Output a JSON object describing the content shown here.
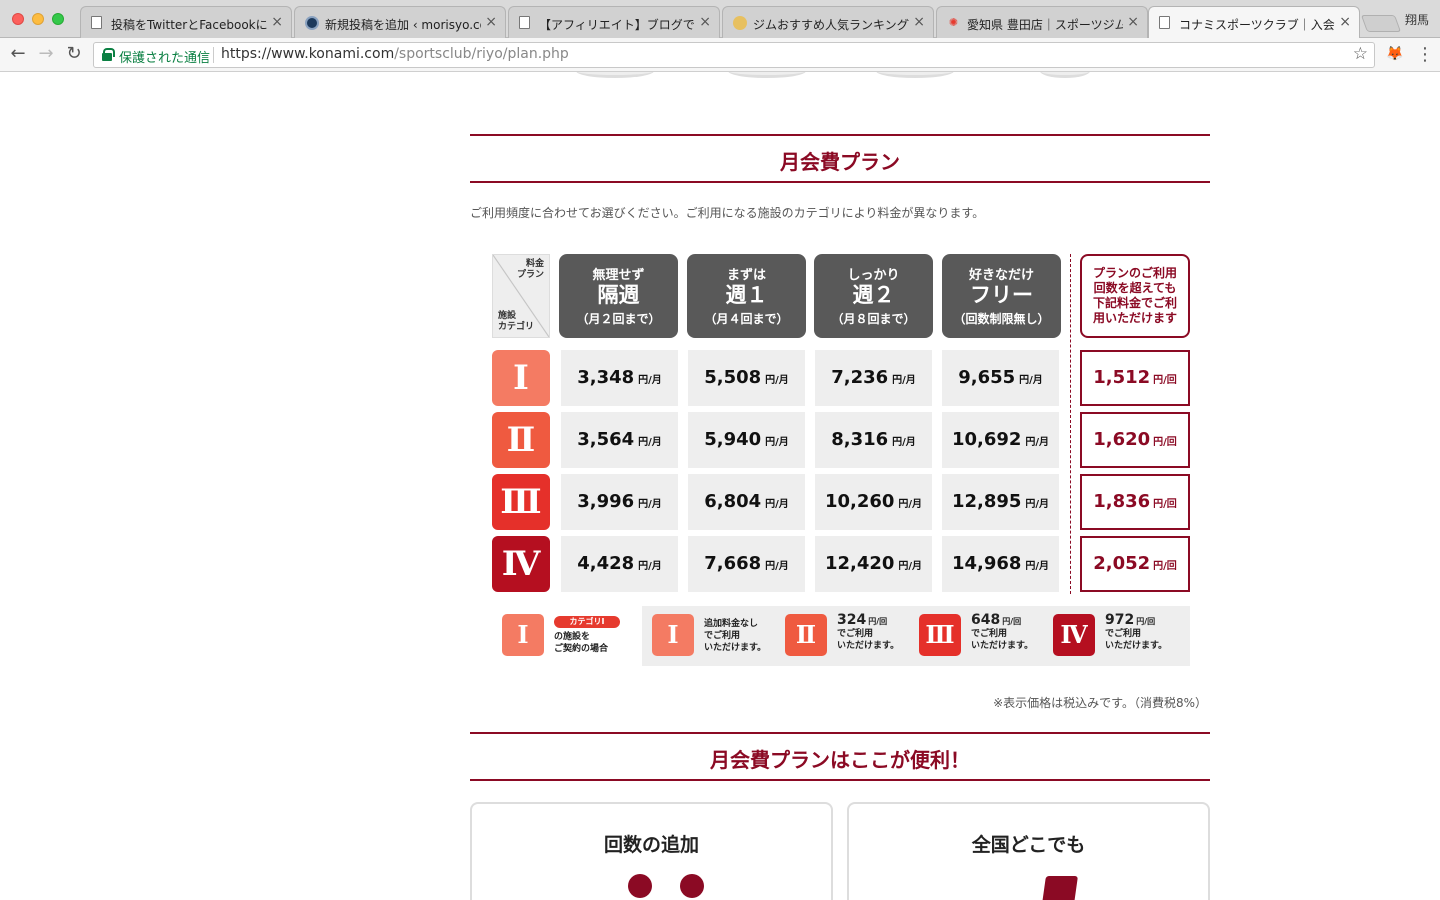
{
  "browser": {
    "tabs": [
      {
        "title": "投稿をTwitterとFacebookに自動",
        "favicon": "doc"
      },
      {
        "title": "新規投稿を追加 ‹ morisyo.com",
        "favicon": "wp"
      },
      {
        "title": "【アフィリエイト】ブログで月",
        "favicon": "doc"
      },
      {
        "title": "ジムおすすめ人気ランキングTO",
        "favicon": "gym"
      },
      {
        "title": "愛知県 豊田店｜スポーツジム、",
        "favicon": "ken"
      },
      {
        "title": "コナミスポーツクラブ｜入会案内",
        "favicon": "doc"
      }
    ],
    "active_tab": 5,
    "profile_name": "翔馬",
    "secure_label": "保護された通信",
    "url_host": "https://www.konami.com",
    "url_path": "/sportsclub/riyo/plan.php"
  },
  "page": {
    "section1_title": "月会費プラン",
    "intro": "ご利用頻度に合わせてお選びください。ご利用になる施設のカテゴリにより料金が異なります。",
    "corner_top": "料金\nプラン",
    "corner_bottom": "施設\nカテゴリ",
    "plans": [
      {
        "sub": "無理せず",
        "name": "隔週",
        "note": "（月２回まで）"
      },
      {
        "sub": "まずは",
        "name": "週１",
        "note": "（月４回まで）"
      },
      {
        "sub": "しっかり",
        "name": "週２",
        "note": "（月８回まで）"
      },
      {
        "sub": "好きなだけ",
        "name": "フリー",
        "note": "（回数制限無し）"
      }
    ],
    "extra_header": "プランのご利用回数を超えても下記料金でご利用いただけます",
    "monthly_unit": "円/月",
    "per_visit_unit": "円/回",
    "categories": [
      {
        "label": "Ⅰ",
        "color": "#f47b63",
        "prices": [
          "3,348",
          "5,508",
          "7,236",
          "9,655"
        ],
        "extra": "1,512"
      },
      {
        "label": "Ⅱ",
        "color": "#ef5a40",
        "prices": [
          "3,564",
          "5,940",
          "8,316",
          "10,692"
        ],
        "extra": "1,620"
      },
      {
        "label": "Ⅲ",
        "color": "#e5302a",
        "prices": [
          "3,996",
          "6,804",
          "10,260",
          "12,895"
        ],
        "extra": "1,836"
      },
      {
        "label": "Ⅳ",
        "color": "#b50f20",
        "prices": [
          "4,428",
          "7,668",
          "12,420",
          "14,968"
        ],
        "extra": "2,052"
      }
    ],
    "legend": {
      "pill": "カテゴリⅠ",
      "contract_text": "の施設を\nご契約の場合",
      "first_text": "追加料金なし\nでご利用\nいただけます。",
      "items": [
        {
          "label": "Ⅱ",
          "price": "324",
          "unit": "円/回",
          "text": "でご利用\nいただけます。"
        },
        {
          "label": "Ⅲ",
          "price": "648",
          "unit": "円/回",
          "text": "でご利用\nいただけます。"
        },
        {
          "label": "Ⅳ",
          "price": "972",
          "unit": "円/回",
          "text": "でご利用\nいただけます。"
        }
      ]
    },
    "tax_note": "※表示価格は税込みです。（消費税8%）",
    "section2_title": "月会費プランはここが便利！",
    "cards": [
      {
        "title": "回数の追加",
        "icon": "people-icon"
      },
      {
        "title": "全国どこでも",
        "icon": "chair-icon"
      }
    ]
  }
}
